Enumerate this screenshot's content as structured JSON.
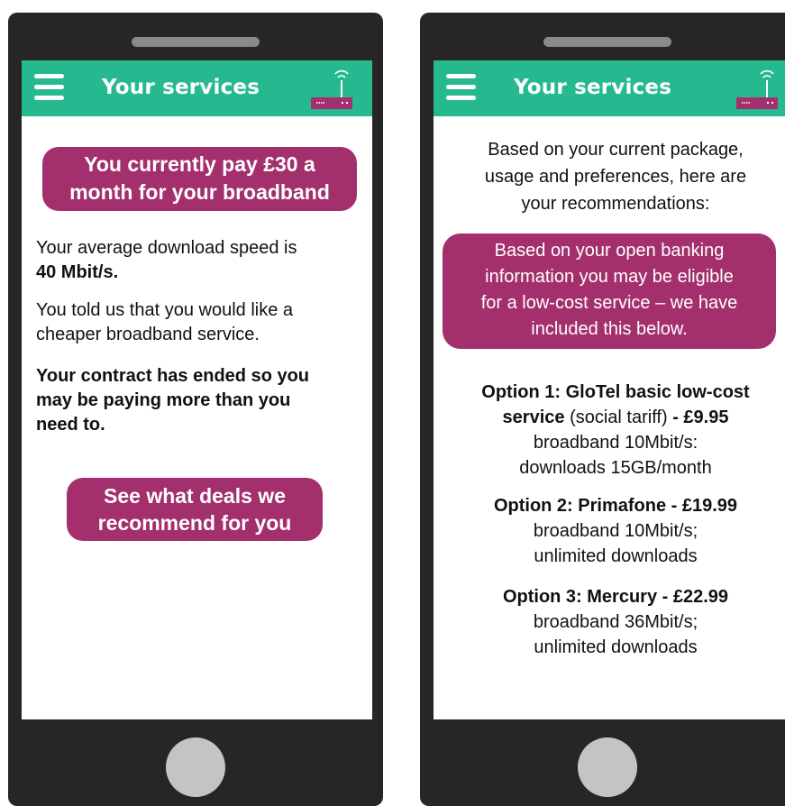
{
  "left_phone": {
    "topbar": {
      "title": "Your services"
    },
    "price_banner": {
      "line1": "You currently pay £30 a",
      "line2": "month for your broadband"
    },
    "speed": {
      "text": "Your average download speed is",
      "value": "40 Mbit/s."
    },
    "preference": {
      "line1": "You told us that you would like a",
      "line2": "cheaper broadband service."
    },
    "contract": {
      "line1": "Your contract has ended so you",
      "line2": "may be paying more than you",
      "line3": "need to."
    },
    "deals_button": {
      "line1": "See what deals we",
      "line2": "recommend for you"
    }
  },
  "right_phone": {
    "topbar": {
      "title": "Your services"
    },
    "intro": {
      "line1": "Based on your current package,",
      "line2": "usage and preferences, here are",
      "line3": "your recommendations:"
    },
    "bank_banner": {
      "line1": "Based on your open banking",
      "line2": "information you may be eligible",
      "line3": "for a low-cost service – we have",
      "line4": "included this below."
    },
    "options": [
      {
        "title_bold": "Option 1: GloTel basic low-cost",
        "name_bold": "service",
        "tariff": " (social tariff) ",
        "price": "- £9.95",
        "detail1": "broadband 10Mbit/s:",
        "detail2": "downloads 15GB/month"
      },
      {
        "title_bold": "Option 2: Primafone - £19.99",
        "detail1": "broadband 10Mbit/s;",
        "detail2": "unlimited downloads"
      },
      {
        "title_bold": "Option 3: Mercury - £22.99",
        "detail1": "broadband 36Mbit/s;",
        "detail2": "unlimited downloads"
      }
    ]
  },
  "icons": [
    "menu-icon",
    "router-icon"
  ],
  "colors": {
    "topbar": "#26b98f",
    "pill": "#a3306d",
    "phone_body": "#282526",
    "home_button": "#c4c4c4"
  }
}
